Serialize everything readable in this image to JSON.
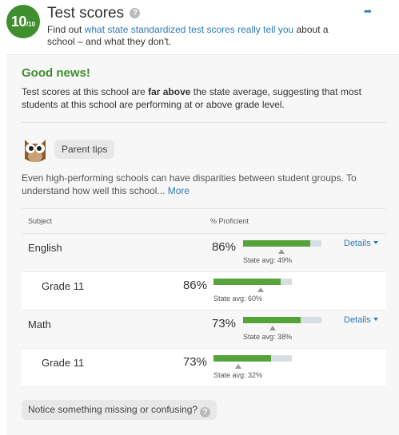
{
  "header": {
    "rating_value": "10",
    "rating_scale": "/10",
    "title": "Test scores",
    "subtitle_link": "what state standardized test scores really tell you",
    "subtitle_pre": "Find out ",
    "subtitle_post": " about a school – and what they don't.",
    "help_icon": "question-circle-icon",
    "share_icon": "share-arrow-icon"
  },
  "summary": {
    "heading": "Good news!",
    "text_pre": "Test scores at this school are ",
    "text_bold": "far above",
    "text_post": " the state average, suggesting that most students at this school are performing at or above grade level."
  },
  "parent_tips": {
    "icon": "owl-icon",
    "label": "Parent tips",
    "text": "Even high-performing schools can have disparities between student groups. To understand how well this school... ",
    "more_link": "More"
  },
  "table": {
    "col_subject": "Subject",
    "col_proficient": "% Proficient",
    "rows": [
      {
        "label": "English",
        "pct_text": "86%",
        "pct": 86,
        "state_text": "State avg: 49%",
        "state": 49,
        "details": "Details",
        "type": "main"
      },
      {
        "label": "Grade 11",
        "pct_text": "86%",
        "pct": 86,
        "state_text": "State avg: 60%",
        "state": 60,
        "type": "sub"
      },
      {
        "label": "Math",
        "pct_text": "73%",
        "pct": 73,
        "state_text": "State avg: 38%",
        "state": 38,
        "details": "Details",
        "type": "main"
      },
      {
        "label": "Grade 11",
        "pct_text": "73%",
        "pct": 73,
        "state_text": "State avg: 32%",
        "state": 32,
        "type": "sub"
      }
    ]
  },
  "feedback": {
    "label": "Notice something missing or confusing?"
  },
  "colors": {
    "accent_green": "#3f8f2e",
    "bar_fill": "#56a33b",
    "link_blue": "#2b7bb9"
  }
}
